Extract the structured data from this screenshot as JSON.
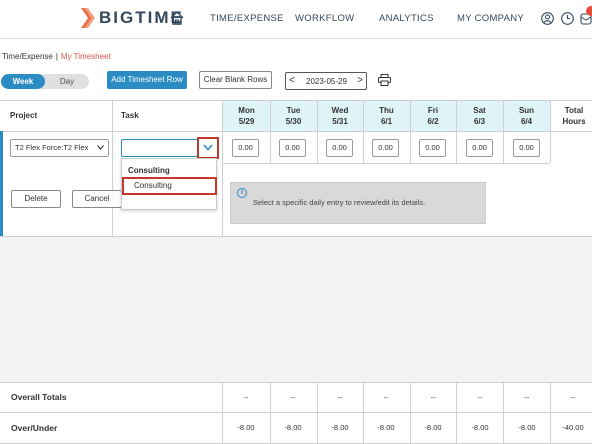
{
  "header": {
    "brand": "BIGTIME",
    "nav": [
      "TIME/EXPENSE",
      "WORKFLOW",
      "ANALYTICS",
      "MY COMPANY"
    ],
    "icons": [
      "home-icon",
      "user-icon",
      "clock-icon",
      "notification-icon"
    ],
    "accent": "#2b8cc4"
  },
  "breadcrumb": {
    "parent": "Time/Expense",
    "separator": "|",
    "current": "My Timesheet"
  },
  "toolbar": {
    "view_week": "Week",
    "view_day": "Day",
    "add_row": "Add Timesheet Row",
    "clear_blank": "Clear Blank Rows",
    "date": "2023-05-29",
    "prev": "<",
    "next": ">"
  },
  "grid": {
    "col_project": "Project",
    "col_task": "Task",
    "days": [
      {
        "name": "Mon",
        "date": "5/29"
      },
      {
        "name": "Tue",
        "date": "5/30"
      },
      {
        "name": "Wed",
        "date": "5/31"
      },
      {
        "name": "Thu",
        "date": "6/1"
      },
      {
        "name": "Fri",
        "date": "6/2"
      },
      {
        "name": "Sat",
        "date": "6/3"
      },
      {
        "name": "Sun",
        "date": "6/4"
      }
    ],
    "col_total_1": "Total",
    "col_total_2": "Hours",
    "row": {
      "project": "T2 Flex Force:T2 Flex",
      "task": "",
      "hours": [
        "0.00",
        "0.00",
        "0.00",
        "0.00",
        "0.00",
        "0.00",
        "0.00"
      ]
    },
    "dropdown": {
      "group": "Consulting",
      "item": "Consulting"
    },
    "delete": "Delete",
    "cancel": "Cancel",
    "info": "Select a specific daily entry to review/edit its details.",
    "overall_label": "Overall Totals",
    "overall": [
      "--",
      "--",
      "--",
      "--",
      "--",
      "--",
      "--",
      "--"
    ],
    "over_under_label": "Over/Under",
    "over_under": [
      "-8.00",
      "-8.00",
      "-8.00",
      "-8.00",
      "-8.00",
      "-8.00",
      "-8.00",
      "-40.00"
    ]
  }
}
